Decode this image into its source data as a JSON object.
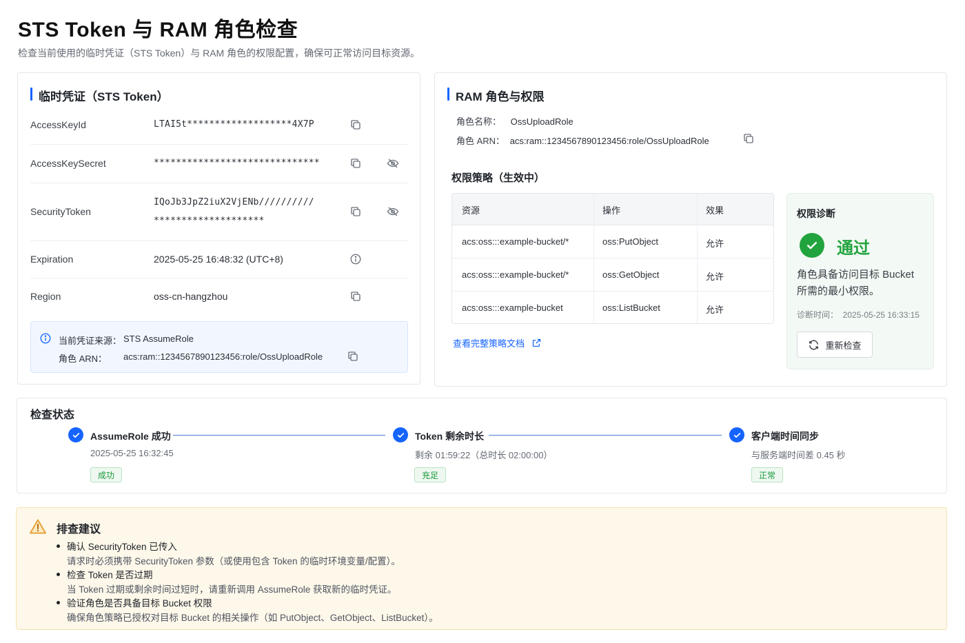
{
  "header": {
    "title": "STS Token 与 RAM 角色检查",
    "subtitle": "检查当前使用的临时凭证（STS Token）与 RAM 角色的权限配置，确保可正常访问目标资源。"
  },
  "credentials": {
    "title": "临时凭证（STS Token）",
    "rows": [
      {
        "key": "AccessKeyId",
        "value": "LTAI5t*******************4X7P"
      },
      {
        "key": "AccessKeySecret",
        "value": "******************************"
      },
      {
        "key": "SecurityToken",
        "value_line1": "IQoJb3JpZ2iuX2VjENb//////////",
        "value_line2": "********************"
      },
      {
        "key": "Expiration",
        "value": "2025-05-25 16:48:32 (UTC+8)"
      },
      {
        "key": "Region",
        "value": "oss-cn-hangzhou"
      }
    ],
    "source": {
      "label": "当前凭证来源：",
      "value": "STS AssumeRole",
      "arn_label": "角色 ARN：",
      "arn_value": "acs:ram::1234567890123456:role/OssUploadRole"
    }
  },
  "role": {
    "title": "RAM 角色与权限",
    "name_label": "角色名称：",
    "name_value": "OssUploadRole",
    "arn_label": "角色 ARN：",
    "arn_value": "acs:ram::1234567890123456:role/OssUploadRole",
    "policy_title": "权限策略（生效中）",
    "table": {
      "headers": [
        "资源",
        "操作",
        "效果"
      ],
      "rows": [
        {
          "resource": "acs:oss:::example-bucket/*",
          "action": "oss:PutObject",
          "effect": "允许"
        },
        {
          "resource": "acs:oss:::example-bucket/*",
          "action": "oss:GetObject",
          "effect": "允许"
        },
        {
          "resource": "acs:oss:::example-bucket",
          "action": "oss:ListBucket",
          "effect": "允许"
        }
      ]
    },
    "policy_link": "查看完整策略文档",
    "diagnosis": {
      "title": "权限诊断",
      "result": "通过",
      "desc_line1": "角色具备访问目标 Bucket",
      "desc_line2": "所需的最小权限。",
      "time": "诊断时间：  2025-05-25 16:33:15",
      "recheck": "重新检查"
    }
  },
  "status": {
    "title": "检查状态",
    "steps": [
      {
        "title": "AssumeRole 成功",
        "sub": "2025-05-25 16:32:45",
        "tag": "成功"
      },
      {
        "title": "Token 剩余时长",
        "sub": "剩余 01:59:22（总时长 02:00:00）",
        "tag": "充足"
      },
      {
        "title": "客户端时间同步",
        "sub": "与服务端时间差 0.45 秒",
        "tag": "正常"
      }
    ]
  },
  "advice": {
    "title": "排查建议",
    "items": [
      {
        "title": "确认 SecurityToken 已传入",
        "desc": "请求时必须携带 SecurityToken 参数（或使用包含 Token 的临时环境变量/配置）。"
      },
      {
        "title": "检查 Token 是否过期",
        "desc": "当 Token 过期或剩余时间过短时，请重新调用 AssumeRole 获取新的临时凭证。"
      },
      {
        "title": "验证角色是否具备目标 Bucket 权限",
        "desc": "确保角色策略已授权对目标 Bucket 的相关操作（如 PutObject、GetObject、ListBucket）。"
      }
    ]
  },
  "colors": {
    "accent": "#1664ff",
    "success": "#1a9a3b",
    "warning": "#e6a23c"
  }
}
